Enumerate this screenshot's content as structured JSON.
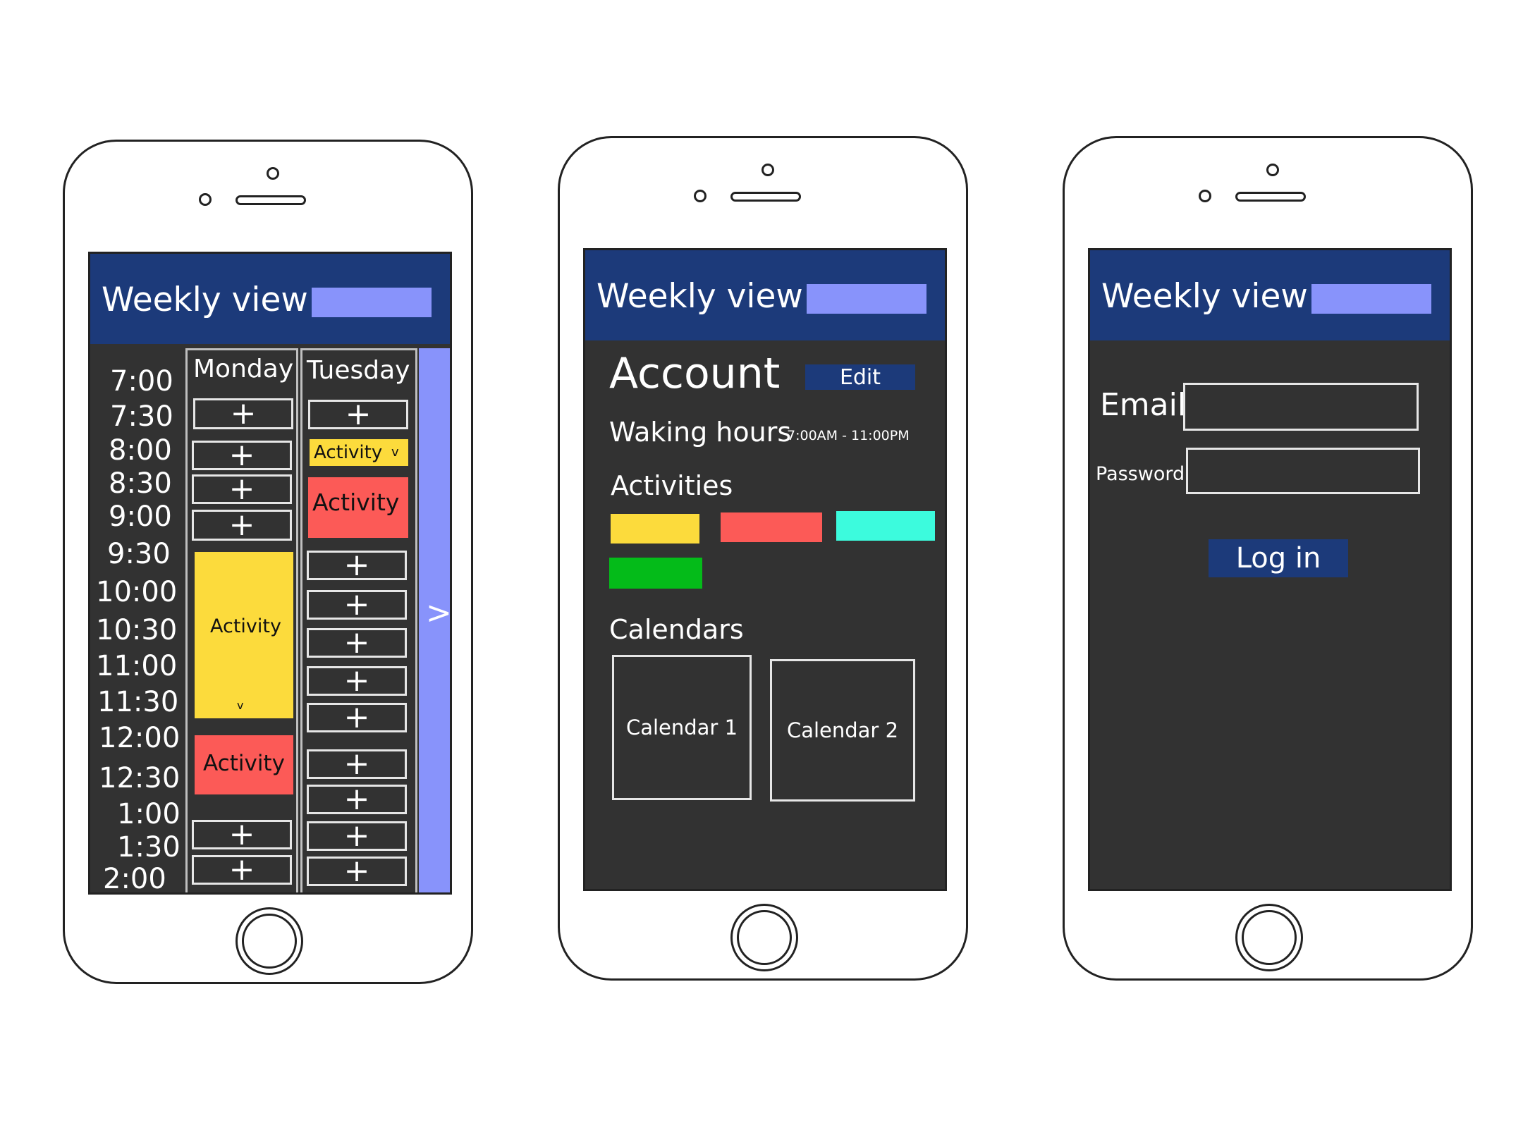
{
  "header": {
    "title": "Weekly view"
  },
  "weekly": {
    "times": [
      "7:00",
      "7:30",
      "8:00",
      "8:30",
      "9:00",
      "9:30",
      "10:00",
      "10:30",
      "11:00",
      "11:30",
      "12:00",
      "12:30",
      "1:00",
      "1:30",
      "2:00"
    ],
    "days": [
      "Monday",
      "Tuesday"
    ],
    "add_symbol": "+",
    "monday_activity_tall": "Activity",
    "monday_activity_tall_chevron": "v",
    "monday_activity_red": "Activity",
    "tuesday_activity_small": "Activity",
    "tuesday_activity_small_chevron": "v",
    "tuesday_activity_red": "Activity",
    "next_arrow": ">"
  },
  "account": {
    "title": "Account",
    "edit_label": "Edit",
    "waking_label": "Waking hours",
    "waking_value": "7:00AM - 11:00PM",
    "activities_label": "Activities",
    "activity_colors": [
      "#fcdb3c",
      "#fc5a57",
      "#3cfbdd",
      "#04bb19"
    ],
    "calendars_label": "Calendars",
    "calendars": [
      "Calendar 1",
      "Calendar 2"
    ]
  },
  "login": {
    "email_label": "Email",
    "password_label": "Password",
    "button_label": "Log in"
  },
  "colors": {
    "header": "#1c3a7a",
    "accent": "#8893fb",
    "screen": "#323232",
    "yellow": "#fcdb3c",
    "red": "#fc5a57"
  }
}
